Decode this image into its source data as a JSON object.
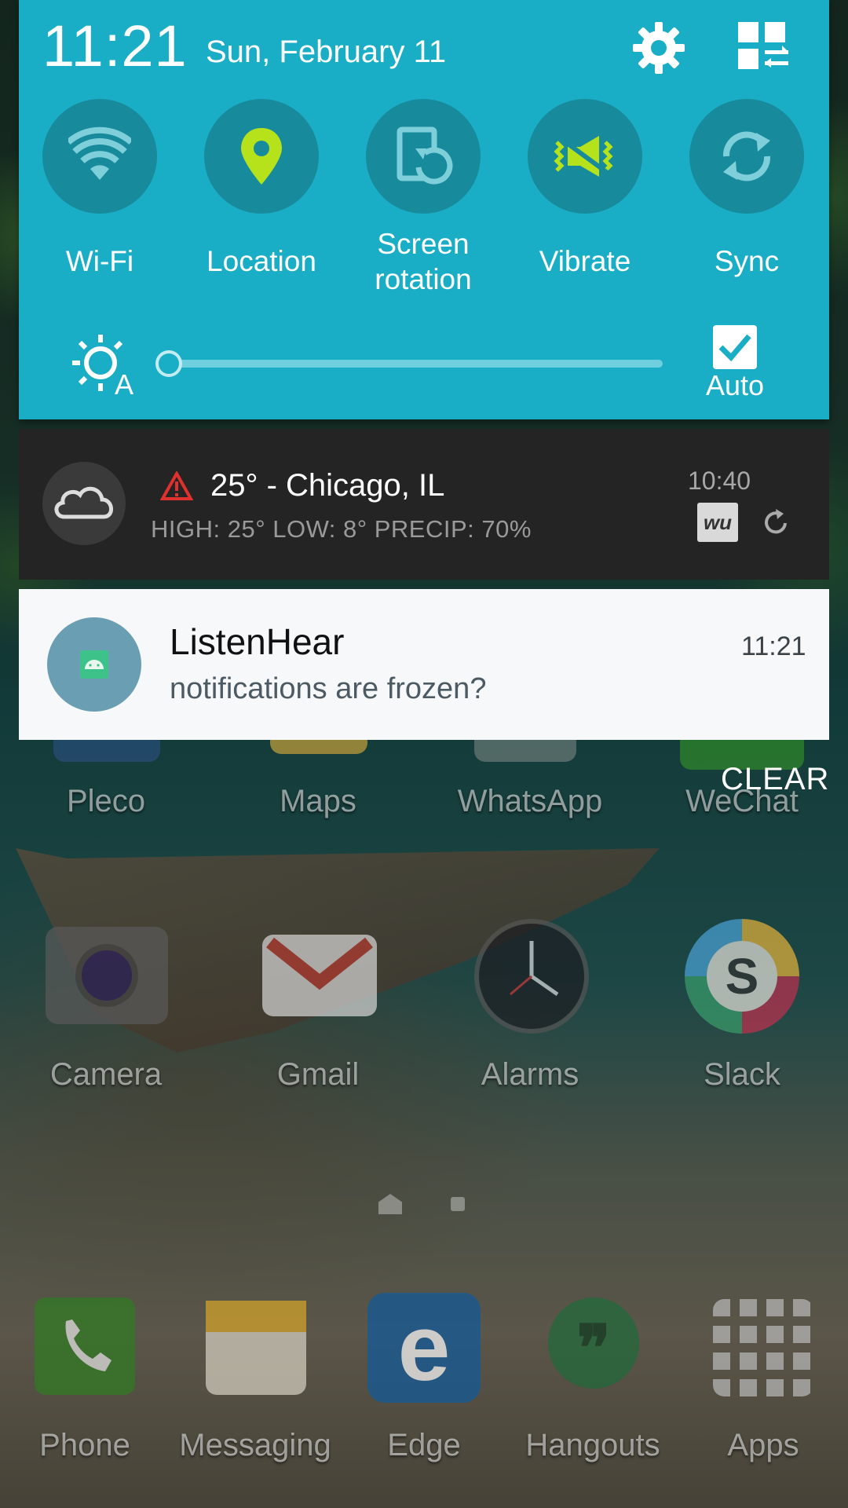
{
  "status": {
    "time": "11:21",
    "date": "Sun, February 11"
  },
  "header_icons": [
    "gear-icon",
    "grid-edit-icon"
  ],
  "quick_toggles": [
    {
      "label": "Wi-Fi",
      "icon": "wifi-icon",
      "active": false
    },
    {
      "label": "Location",
      "icon": "location-pin-icon",
      "active": true
    },
    {
      "label_line1": "Screen",
      "label_line2": "rotation",
      "icon": "screen-rotation-icon",
      "active": false
    },
    {
      "label": "Vibrate",
      "icon": "vibrate-icon",
      "active": true
    },
    {
      "label": "Sync",
      "icon": "sync-icon",
      "active": false
    }
  ],
  "brightness": {
    "level": 0.0,
    "auto_label": "Auto",
    "auto_checked": true
  },
  "weather_notification": {
    "title": "25° - Chicago, IL",
    "details": "HIGH: 25° LOW: 8° PRECIP: 70%",
    "time": "10:40",
    "badge": "wu",
    "icons": [
      "cloud-icon",
      "warning-triangle-icon",
      "refresh-icon"
    ]
  },
  "app_notification": {
    "app": "ListenHear",
    "message": "notifications are frozen?",
    "time": "11:21",
    "icon": "android-icon"
  },
  "clear_label": "CLEAR",
  "home_apps_row1": [
    "Pleco",
    "Maps",
    "WhatsApp",
    "WeChat"
  ],
  "home_apps_row2": [
    "Camera",
    "Gmail",
    "Alarms",
    "Slack"
  ],
  "dock_apps": [
    "Phone",
    "Messaging",
    "Edge",
    "Hangouts",
    "Apps"
  ],
  "colors": {
    "panel": "#1aaec6",
    "toggle_bg": "#178b9c",
    "active_icon": "#b6e21b",
    "inactive_icon": "#8fd4de"
  }
}
